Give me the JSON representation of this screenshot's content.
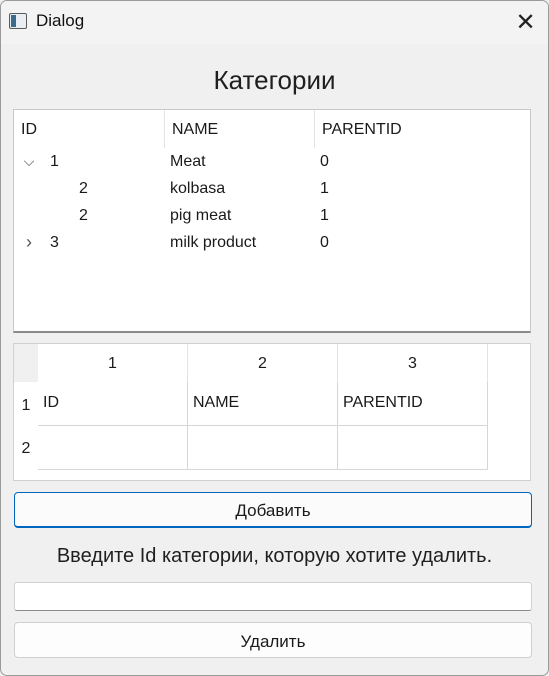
{
  "window": {
    "title": "Dialog",
    "close_glyph": "✕"
  },
  "heading": "Категории",
  "tree": {
    "columns": [
      "ID",
      "NAME",
      "PARENTID"
    ],
    "rows": [
      {
        "toggle": "chevron-down-icon",
        "toggle_glyph": "⌵",
        "id": "1",
        "name": "Meat",
        "parentid": "0"
      },
      {
        "toggle": null,
        "id": "2",
        "name": "kolbasa",
        "parentid": "1"
      },
      {
        "toggle": null,
        "id": "2",
        "name": "pig meat",
        "parentid": "1"
      },
      {
        "toggle": "chevron-right-icon",
        "toggle_glyph": "›",
        "id": "3",
        "name": "milk product",
        "parentid": "0"
      }
    ]
  },
  "table": {
    "column_headers": [
      "1",
      "2",
      "3"
    ],
    "row_headers": [
      "1",
      "2"
    ],
    "cells": [
      [
        "ID",
        "NAME",
        "PARENTID"
      ],
      [
        "",
        "",
        ""
      ]
    ]
  },
  "add_button": "Добавить",
  "delete_prompt": "Введите Id категории, которую хотите удалить.",
  "delete_input": {
    "value": "",
    "placeholder": ""
  },
  "delete_button": "Удалить",
  "colors": {
    "accent": "#0067c0",
    "background": "#f0f0f0"
  }
}
